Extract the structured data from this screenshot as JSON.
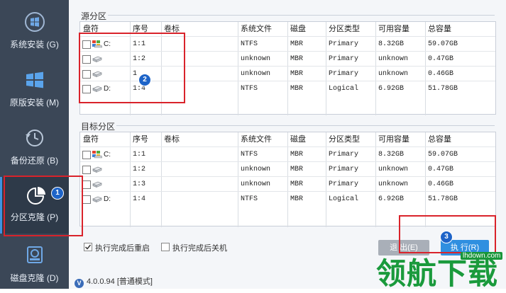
{
  "sidebar": {
    "items": [
      {
        "label": "系统安装 (G)",
        "icon": "windows-logo-icon"
      },
      {
        "label": "原版安装 (M)",
        "icon": "windows-tiles-icon"
      },
      {
        "label": "备份还原 (B)",
        "icon": "restore-clock-icon"
      },
      {
        "label": "分区克隆 (P)",
        "icon": "pie-chart-icon",
        "active": true
      },
      {
        "label": "磁盘克隆 (D)",
        "icon": "disk-clone-icon"
      }
    ]
  },
  "source": {
    "group_title": "源分区",
    "columns": [
      "盘符",
      "序号",
      "卷标",
      "系统文件",
      "磁盘",
      "分区类型",
      "可用容量",
      "总容量"
    ],
    "rows": [
      {
        "drive": "C:",
        "num": "1:1",
        "label": "",
        "fs": "NTFS",
        "disk": "MBR",
        "type": "Primary",
        "free": "8.32GB",
        "total": "59.07GB",
        "windows": true
      },
      {
        "drive": "",
        "num": "1:2",
        "label": "",
        "fs": "unknown",
        "disk": "MBR",
        "type": "Primary",
        "free": "unknown",
        "total": "0.47GB"
      },
      {
        "drive": "",
        "num": "1",
        "label": "",
        "fs": "unknown",
        "disk": "MBR",
        "type": "Primary",
        "free": "unknown",
        "total": "0.46GB"
      },
      {
        "drive": "D:",
        "num": "1:4",
        "label": "",
        "fs": "NTFS",
        "disk": "MBR",
        "type": "Logical",
        "free": "6.92GB",
        "total": "51.78GB"
      }
    ]
  },
  "target": {
    "group_title": "目标分区",
    "columns": [
      "盘符",
      "序号",
      "卷标",
      "系统文件",
      "磁盘",
      "分区类型",
      "可用容量",
      "总容量"
    ],
    "rows": [
      {
        "drive": "C:",
        "num": "1:1",
        "label": "",
        "fs": "NTFS",
        "disk": "MBR",
        "type": "Primary",
        "free": "8.32GB",
        "total": "59.07GB",
        "windows": true
      },
      {
        "drive": "",
        "num": "1:2",
        "label": "",
        "fs": "unknown",
        "disk": "MBR",
        "type": "Primary",
        "free": "unknown",
        "total": "0.47GB"
      },
      {
        "drive": "",
        "num": "1:3",
        "label": "",
        "fs": "unknown",
        "disk": "MBR",
        "type": "Primary",
        "free": "unknown",
        "total": "0.46GB"
      },
      {
        "drive": "D:",
        "num": "1:4",
        "label": "",
        "fs": "NTFS",
        "disk": "MBR",
        "type": "Logical",
        "free": "6.92GB",
        "total": "51.78GB"
      }
    ]
  },
  "options": {
    "restart_after": {
      "label": "执行完成后重启",
      "checked": true
    },
    "shutdown_after": {
      "label": "执行完成后关机",
      "checked": false
    }
  },
  "buttons": {
    "exit": "退 出(E)",
    "execute": "执 行(R)"
  },
  "badges": {
    "one": "1",
    "two": "2",
    "three": "3"
  },
  "status": {
    "version": "4.0.0.94 [普通模式]"
  },
  "watermark": {
    "text": "领航下载",
    "url": "lhdown.com"
  },
  "colors": {
    "sidebar": "#3b4757",
    "accent": "#1e64c8",
    "highlight": "#d9232b",
    "execute_button": "#2f8fe0"
  }
}
